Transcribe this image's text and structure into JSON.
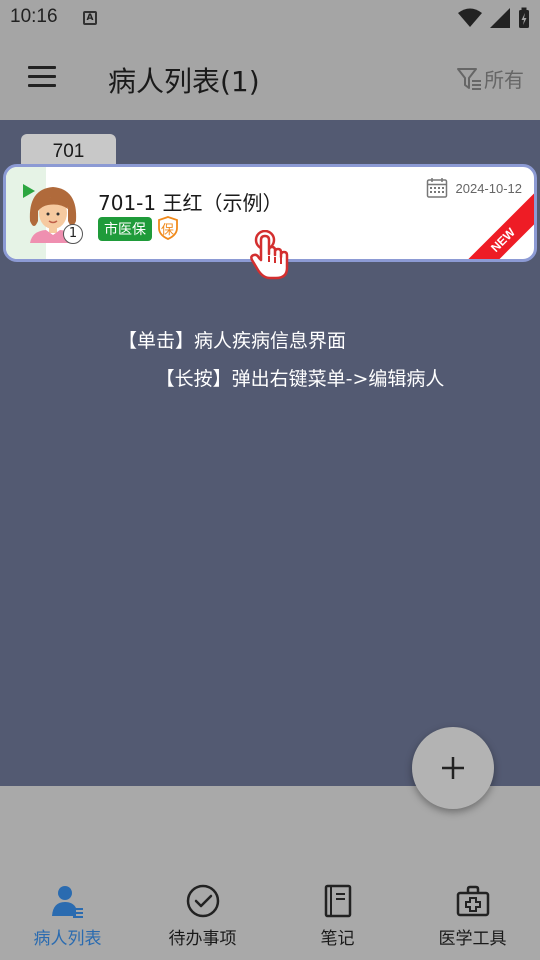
{
  "status_bar": {
    "time": "10:16",
    "notification_glyph": "A"
  },
  "app_bar": {
    "title": "病人列表(1)",
    "filter_label": "所有"
  },
  "group": {
    "label": "701"
  },
  "patient": {
    "name": "701-1 王红（示例）",
    "insurance_tag": "市医保",
    "bao_badge": "保",
    "date": "2024-10-12",
    "visit_count": "1",
    "ribbon": "NEW"
  },
  "hints": {
    "tap": "【单击】病人疾病信息界面",
    "long_press": "【长按】弹出右键菜单->编辑病人"
  },
  "fab": {
    "icon": "plus-icon"
  },
  "bottom_nav": {
    "items": [
      {
        "label": "病人列表",
        "icon": "patient-list-icon",
        "active": true
      },
      {
        "label": "待办事项",
        "icon": "check-circle-icon",
        "active": false
      },
      {
        "label": "笔记",
        "icon": "notebook-icon",
        "active": false
      },
      {
        "label": "医学工具",
        "icon": "medical-kit-icon",
        "active": false
      }
    ]
  },
  "colors": {
    "accent": "#2a6bb0",
    "content_bg": "#535a72",
    "insurance_green": "#1f9b3a",
    "ribbon_red": "#ee1c25",
    "card_border": "#8c9ad4"
  }
}
